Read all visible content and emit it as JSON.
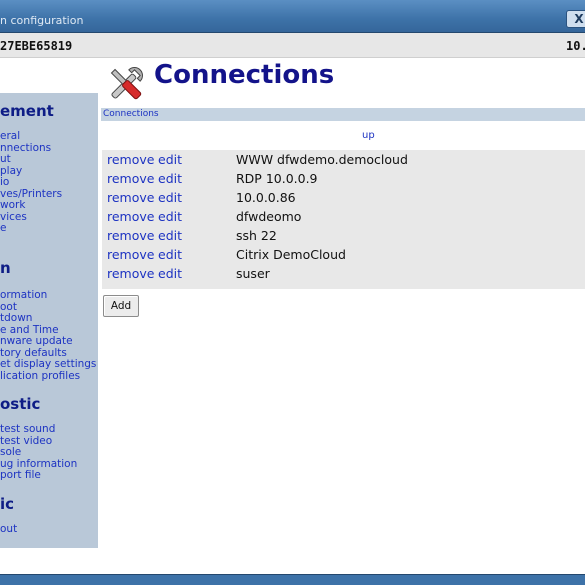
{
  "window": {
    "title": "n configuration",
    "close_label": "X"
  },
  "info": {
    "device_id": "27EBE65819",
    "ip": "10."
  },
  "sidebar": {
    "sections": [
      {
        "heading": "ement",
        "items": [
          "eral",
          "nnections",
          "ut",
          "play",
          "io",
          "ves/Printers",
          "work",
          "vices",
          "e"
        ]
      },
      {
        "heading": "n",
        "items": [
          "ormation",
          "oot",
          "tdown",
          "e and Time",
          "nware update",
          "tory defaults",
          "et display settings",
          "lication profiles"
        ]
      },
      {
        "heading": "ostic",
        "items": [
          "test sound",
          "test video",
          "sole",
          "ug information",
          "port file"
        ]
      },
      {
        "heading": "ic",
        "items": [
          "out"
        ]
      }
    ]
  },
  "page": {
    "title": "Connections",
    "icon": "tools-icon",
    "breadcrumb": "Connections",
    "up_label": "up",
    "remove_label": "remove",
    "edit_label": "edit",
    "add_label": "Add"
  },
  "connections": [
    "WWW dfwdemo.democloud",
    "RDP 10.0.0.9",
    "10.0.0.86",
    "dfwdeomo",
    "ssh 22",
    "Citrix DemoCloud",
    "suser"
  ]
}
